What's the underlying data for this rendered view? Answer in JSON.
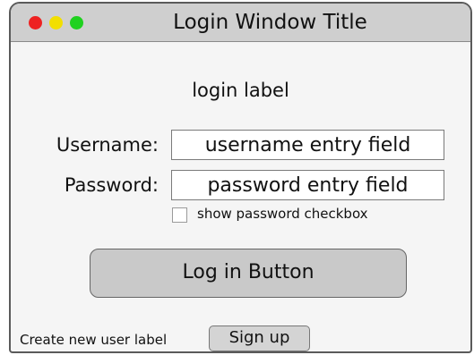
{
  "window": {
    "title": "Login Window Title"
  },
  "form": {
    "login_label": "login label",
    "username_label": "Username:",
    "username_value": "username entry field",
    "password_label": "Password:",
    "password_value": "password entry field",
    "show_password_label": "show password checkbox",
    "show_password_checked": false,
    "login_button_label": "Log in Button"
  },
  "footer": {
    "create_user_label": "Create new user label",
    "signup_button_label": "Sign up"
  },
  "colors": {
    "close": "#ee2222",
    "minimize": "#f2df00",
    "zoom": "#1fd11f",
    "titlebar": "#cfcfcf",
    "button": "#c9c9c9"
  }
}
